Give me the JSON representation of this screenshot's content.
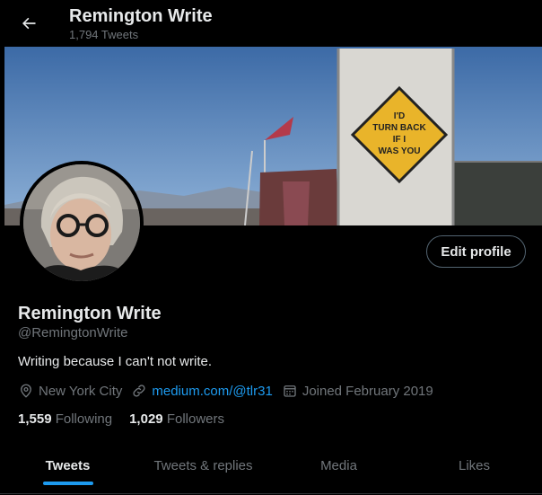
{
  "header": {
    "title": "Remington Write",
    "tweet_count": "1,794 Tweets",
    "back_icon": "arrow-left-icon"
  },
  "banner": {
    "sign_lines": [
      "I'D",
      "TURN BACK",
      "IF I",
      "WAS YOU"
    ]
  },
  "profile": {
    "edit_label": "Edit profile",
    "name": "Remington Write",
    "handle": "@RemingtonWrite",
    "bio": "Writing because I can't not write.",
    "location": "New York City",
    "website": "medium.com/@tlr31",
    "joined": "Joined February 2019",
    "following_count": "1,559",
    "following_label": "Following",
    "followers_count": "1,029",
    "followers_label": "Followers"
  },
  "tabs": [
    {
      "label": "Tweets",
      "active": true
    },
    {
      "label": "Tweets & replies",
      "active": false
    },
    {
      "label": "Media",
      "active": false
    },
    {
      "label": "Likes",
      "active": false
    }
  ],
  "colors": {
    "background": "#000000",
    "accent": "#1d9bf0",
    "secondary_text": "#71767b",
    "primary_text": "#e7e9ea"
  }
}
